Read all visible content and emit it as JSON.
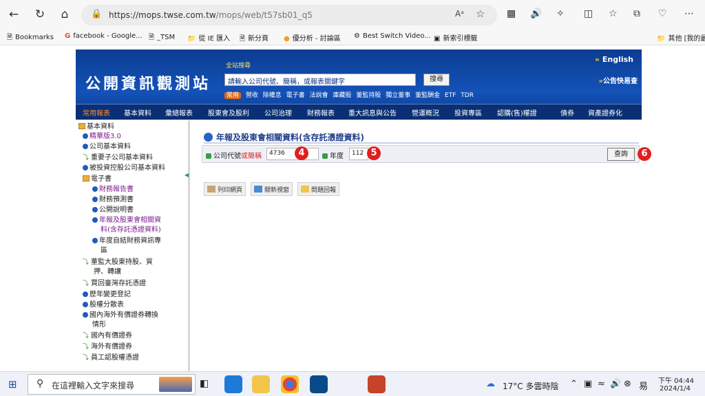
{
  "browser": {
    "url_host": "https://mops.twse.com.tw",
    "url_path": "/mops/web/t57sb01_q5",
    "read_aloud": "Aᵃ"
  },
  "bookmarks": [
    "Bookmarks",
    "facebook - Google...",
    "_TSM",
    "從 IE 匯入",
    "新分頁",
    "優分析 - 討論區",
    "Best Switch Video...",
    "新索引標籤",
    "其他 [我的最"
  ],
  "header": {
    "logo": "公開資訊觀測站",
    "search_title": "全站搜尋",
    "search_placeholder": "請輸入公司代號、簡稱，或報表關鍵字",
    "search_button": "搜尋",
    "quick_tag": "常用",
    "quick_links": [
      "營收",
      "除權息",
      "電子書",
      "法說會",
      "庫藏股",
      "董監持股",
      "獨立董事",
      "董監酬金",
      "ETF",
      "TDR"
    ],
    "english": "English",
    "announce": "公告快易查",
    "menu": [
      "常用報表",
      "基本資料",
      "彙總報表",
      "股東會及股利",
      "公司治理",
      "財務報表",
      "重大訊息與公告",
      "營運概況",
      "投資專區",
      "認購(售)權證",
      "債券",
      "資產證券化"
    ]
  },
  "sidebar": [
    "基本資料",
    "精華版3.0",
    "公司基本資料",
    "重要子公司基本資料",
    "被投資控股公司基本資料",
    "電子書",
    "財務報告書",
    "財務預測書",
    "公開說明書",
    "年報及股東會相關資",
    "料(含存託憑證資料)",
    "年度自結財務資訊專",
    "區",
    "董監大股東持股、質",
    "押、轉讓",
    "買回臺灣存託憑證",
    "歷年變更登記",
    "股權分散表",
    "國內海外有價證券轉換",
    "情形",
    "國內有價證券",
    "海外有價證券",
    "員工認股權憑證"
  ],
  "main": {
    "title": "年報及股東會相關資料(含存託憑證資料)",
    "company_label": "公司代號",
    "company_label_or": "或簡稱",
    "company_value": "4736",
    "year_label": "年度",
    "year_value": "112",
    "query_button": "查詢",
    "badges": [
      "4",
      "5",
      "6"
    ],
    "tools": [
      "列印網頁",
      "開新視窗",
      "問題回報"
    ]
  },
  "taskbar": {
    "search_placeholder": "在這裡輸入文字來搜尋",
    "weather": "17°C 多雲時陰",
    "time": "下午 04:44",
    "date": "2024/1/4",
    "ime": "易"
  }
}
